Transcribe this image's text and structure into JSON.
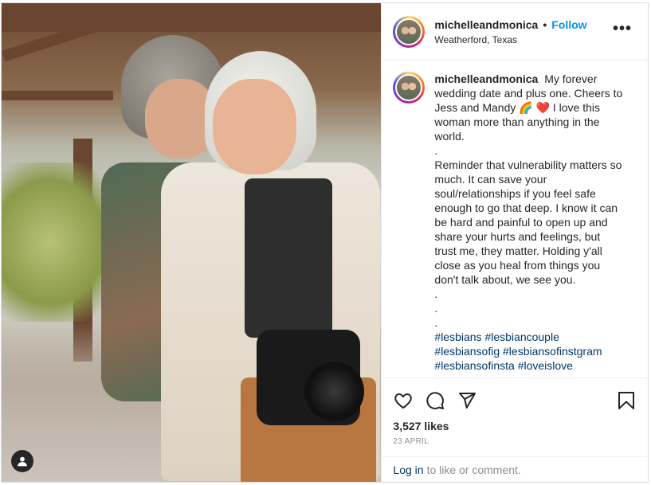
{
  "post": {
    "username": "michelleandmonica",
    "separator": "•",
    "follow_label": "Follow",
    "location": "Weatherford, Texas",
    "more_icon": "more-horizontal-icon",
    "more_label": "•••"
  },
  "caption": {
    "username": "michelleandmonica",
    "lines": [
      "My forever",
      "wedding date and plus one. Cheers to",
      "Jess and Mandy 🌈 ❤️  I love this",
      "woman more than anything in the",
      "world.",
      ".",
      "Reminder that vulnerability matters so",
      "much. It can save your",
      "soul/relationships if you feel safe",
      "enough to go that deep. I know it can",
      "be hard and painful to open up and",
      "share your hurts and feelings, but",
      "trust me, they matter. Holding y'all",
      "close as you heal from things you",
      "don't talk about, we see you.",
      ".",
      ".",
      "."
    ],
    "hashtags": [
      "#lesbians #lesbiancouple",
      "#lesbiansofig #lesbiansofinstgram",
      "#lesbiansofinsta #loveislove"
    ]
  },
  "actions": {
    "like_icon": "heart-icon",
    "comment_icon": "comment-icon",
    "share_icon": "share-icon",
    "save_icon": "bookmark-icon"
  },
  "likes_label": "3,527 likes",
  "date_label": "23 APRIL",
  "login": {
    "link": "Log in",
    "rest": "to like or comment."
  },
  "colors": {
    "follow": "#0095f6",
    "hashtag": "#00376b",
    "muted": "#8e8e8e",
    "text": "#262626"
  }
}
